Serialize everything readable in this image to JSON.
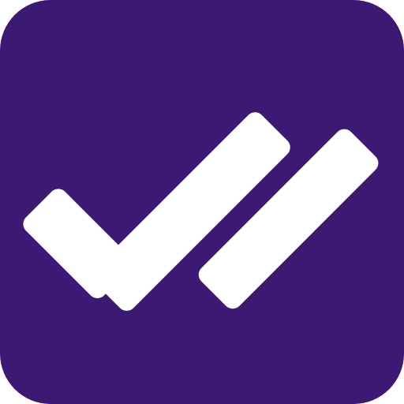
{
  "icon": {
    "name": "double-check-icon",
    "background_color": "#3c1a74",
    "foreground_color": "#ffffff"
  }
}
